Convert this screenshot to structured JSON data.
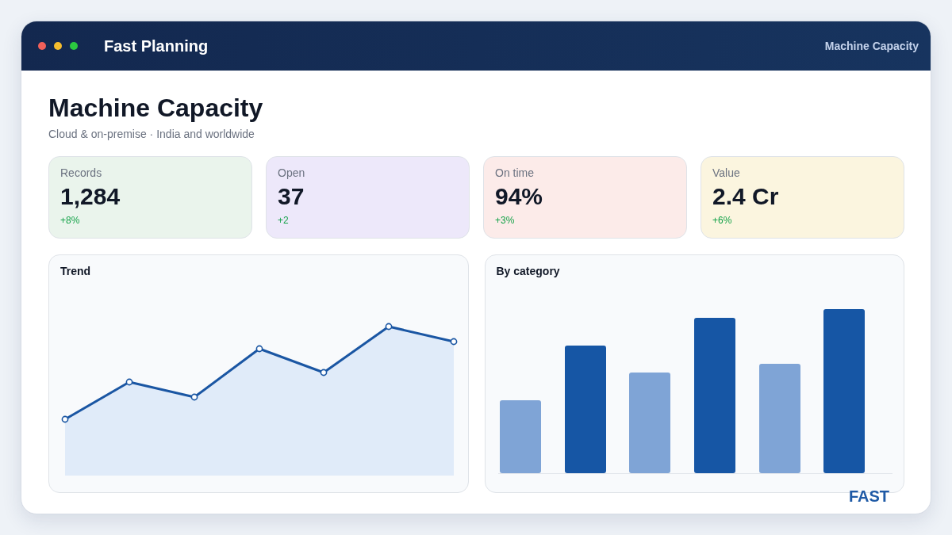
{
  "window": {
    "title": "Fast Planning",
    "header_label": "Machine Capacity"
  },
  "page": {
    "title": "Machine Capacity",
    "subtitle": "Cloud & on-premise · India and worldwide"
  },
  "stats": [
    {
      "label": "Records",
      "value": "1,284",
      "change": "+8%",
      "color": "#eaf4ec"
    },
    {
      "label": "Open",
      "value": "37",
      "change": "+2",
      "color": "#ede8fa"
    },
    {
      "label": "On time",
      "value": "94%",
      "change": "+3%",
      "color": "#fcebe9"
    },
    {
      "label": "Value",
      "value": "2.4 Cr",
      "change": "+6%",
      "color": "#fbf5df"
    }
  ],
  "panels": [
    {
      "title": "Trend",
      "kind": "line"
    },
    {
      "title": "By category",
      "kind": "bar"
    }
  ],
  "brand_mark": "FAST"
}
